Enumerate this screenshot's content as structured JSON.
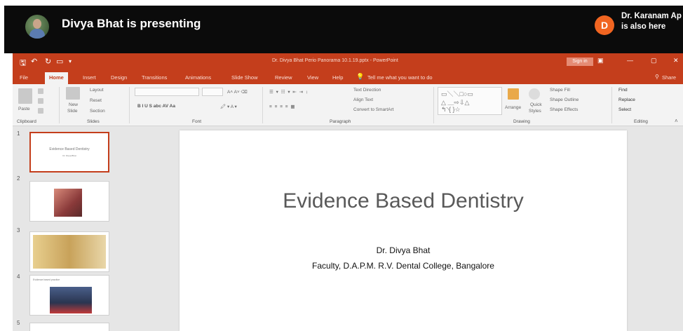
{
  "meeting": {
    "presenter_text": "Divya Bhat is presenting",
    "attendee_initial": "D",
    "attendee_name": "Dr. Karanam Ap",
    "attendee_sub": "is also here"
  },
  "ppt": {
    "doc_title": "Dr. Divya Bhat Perio Panorama 10.1.19.pptx - PowerPoint",
    "sign_in": "Sign in",
    "tabs": [
      {
        "label": "File"
      },
      {
        "label": "Home"
      },
      {
        "label": "Insert"
      },
      {
        "label": "Design"
      },
      {
        "label": "Transitions"
      },
      {
        "label": "Animations"
      },
      {
        "label": "Slide Show"
      },
      {
        "label": "Review"
      },
      {
        "label": "View"
      },
      {
        "label": "Help"
      },
      {
        "label": "Tell me what you want to do"
      },
      {
        "label": "Share"
      }
    ],
    "ribbon": {
      "paste": "Paste",
      "new_slide_1": "New",
      "new_slide_2": "Slide",
      "layout": "Layout",
      "reset": "Reset",
      "section": "Section",
      "text_direction": "Text Direction",
      "align_text": "Align Text",
      "convert_smartart": "Convert to SmartArt",
      "arrange": "Arrange",
      "quick_styles_1": "Quick",
      "quick_styles_2": "Styles",
      "shape_fill": "Shape Fill",
      "shape_outline": "Shape Outline",
      "shape_effects": "Shape Effects",
      "find": "Find",
      "replace": "Replace",
      "select": "Select",
      "format_bar": "B  I  U  S  abc  AV  Aa",
      "groups": {
        "clipboard": "Clipboard",
        "slides": "Slides",
        "font": "Font",
        "paragraph": "Paragraph",
        "drawing": "Drawing",
        "editing": "Editing"
      }
    }
  },
  "thumbnails": [
    {
      "num": "1",
      "title": "Evidence Based Dentistry",
      "sub": "Dr. Divya Bhat"
    },
    {
      "num": "2"
    },
    {
      "num": "3"
    },
    {
      "num": "4",
      "heading": "Evidence based practice"
    },
    {
      "num": "5"
    }
  ],
  "slide": {
    "title": "Evidence Based Dentistry",
    "author": "Dr. Divya Bhat",
    "affiliation": "Faculty, D.A.P.M. R.V. Dental College, Bangalore"
  },
  "colors": {
    "accent": "#c43e1c",
    "presenter_bar": "#0b0b0b",
    "attendee_avatar": "#f16521"
  }
}
